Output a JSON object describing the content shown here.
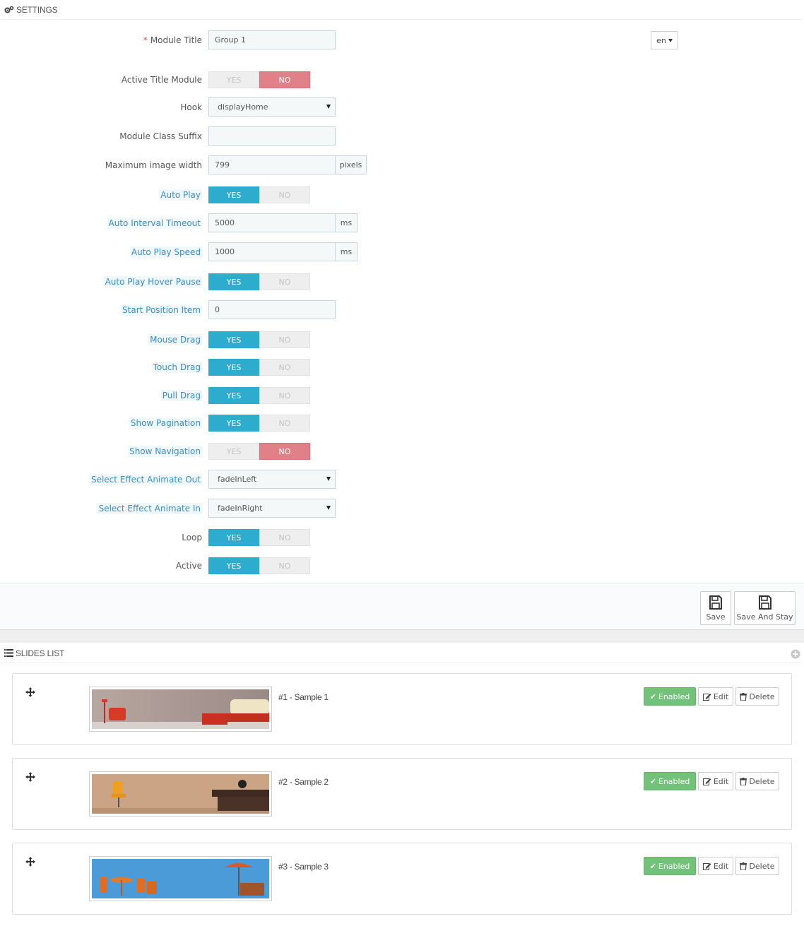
{
  "settings": {
    "heading": "SETTINGS",
    "lang": "en",
    "fields": {
      "module_title": {
        "label": "Module Title",
        "required": "*",
        "value": "Group 1"
      },
      "active_title_module": {
        "label": "Active Title Module",
        "state": "NO"
      },
      "hook": {
        "label": "Hook",
        "value": "displayHome"
      },
      "module_class_suffix": {
        "label": "Module Class Suffix",
        "value": ""
      },
      "max_image_width": {
        "label": "Maximum image width",
        "value": "799",
        "unit": "pixels"
      },
      "auto_play": {
        "label": "Auto Play",
        "state": "YES"
      },
      "auto_interval_timeout": {
        "label": "Auto Interval Timeout",
        "value": "5000",
        "unit": "ms"
      },
      "auto_play_speed": {
        "label": "Auto Play Speed",
        "value": "1000",
        "unit": "ms"
      },
      "auto_play_hover_pause": {
        "label": "Auto Play Hover Pause",
        "state": "YES"
      },
      "start_position_item": {
        "label": "Start Position Item",
        "value": "0"
      },
      "mouse_drag": {
        "label": "Mouse Drag",
        "state": "YES"
      },
      "touch_drag": {
        "label": "Touch Drag",
        "state": "YES"
      },
      "pull_drag": {
        "label": "Pull Drag",
        "state": "YES"
      },
      "show_pagination": {
        "label": "Show Pagination",
        "state": "YES"
      },
      "show_navigation": {
        "label": "Show Navigation",
        "state": "NO"
      },
      "effect_out": {
        "label": "Select Effect Animate Out",
        "value": "fadeInLeft"
      },
      "effect_in": {
        "label": "Select Effect Animate In",
        "value": "fadeInRight"
      },
      "loop": {
        "label": "Loop",
        "state": "YES"
      },
      "active": {
        "label": "Active",
        "state": "YES"
      }
    },
    "switch_labels": {
      "yes": "YES",
      "no": "NO"
    },
    "save_label": "Save",
    "save_stay_label": "Save And Stay"
  },
  "slides": {
    "heading": "SLIDES LIST",
    "items": [
      {
        "title": "#1 - Sample 1",
        "status": "Enabled",
        "edit": "Edit",
        "delete": "Delete"
      },
      {
        "title": "#2 - Sample 2",
        "status": "Enabled",
        "edit": "Edit",
        "delete": "Delete"
      },
      {
        "title": "#3 - Sample 3",
        "status": "Enabled",
        "edit": "Edit",
        "delete": "Delete"
      }
    ]
  },
  "colors": {
    "switch_yes": "#2eacce",
    "switch_no": "#e08088",
    "enabled_green": "#72c279",
    "tip_label": "#3a8dc8"
  }
}
